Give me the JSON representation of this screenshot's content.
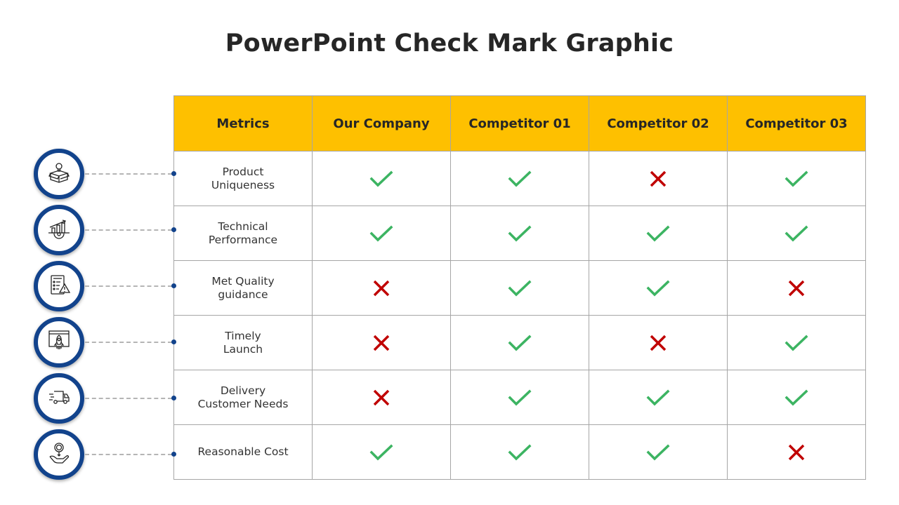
{
  "title": "PowerPoint Check Mark Graphic",
  "colors": {
    "header_bg": "#fec000",
    "circle_border": "#12438c",
    "check": "#3cb462",
    "cross": "#c00000"
  },
  "table": {
    "headers": [
      "Metrics",
      "Our Company",
      "Competitor 01",
      "Competitor 02",
      "Competitor 03"
    ],
    "rows": [
      {
        "metric_lines": [
          "Product",
          "Uniqueness"
        ],
        "icon": "box-lightbulb-icon",
        "values": [
          "check",
          "check",
          "cross",
          "check"
        ]
      },
      {
        "metric_lines": [
          "Technical",
          "Performance"
        ],
        "icon": "chart-gear-icon",
        "values": [
          "check",
          "check",
          "check",
          "check"
        ]
      },
      {
        "metric_lines": [
          "Met Quality",
          "guidance"
        ],
        "icon": "checklist-warning-icon",
        "values": [
          "cross",
          "check",
          "check",
          "cross"
        ]
      },
      {
        "metric_lines": [
          "Timely",
          "Launch"
        ],
        "icon": "rocket-launch-icon",
        "values": [
          "cross",
          "check",
          "cross",
          "check"
        ]
      },
      {
        "metric_lines": [
          "Delivery",
          "Customer Needs"
        ],
        "icon": "delivery-truck-icon",
        "values": [
          "cross",
          "check",
          "check",
          "check"
        ]
      },
      {
        "metric_lines": [
          "Reasonable Cost"
        ],
        "icon": "coin-hand-icon",
        "values": [
          "check",
          "check",
          "check",
          "cross"
        ]
      }
    ]
  }
}
